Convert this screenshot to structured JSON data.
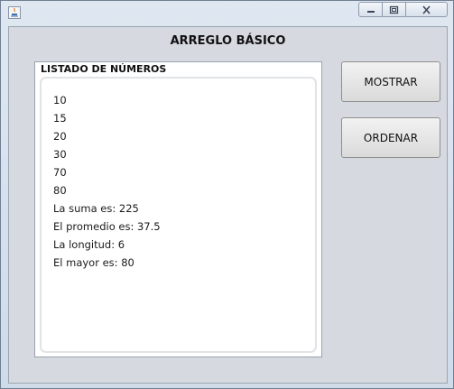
{
  "window": {
    "controls": {
      "minimize_icon": "minimize-icon",
      "maximize_icon": "maximize-icon",
      "close_icon": "close-icon"
    }
  },
  "main": {
    "title": "ARREGLO BÁSICO",
    "list_panel": {
      "title": "LISTADO DE NÚMEROS",
      "lines": [
        "10",
        "15",
        "20",
        "30",
        "70",
        "80",
        "La suma es: 225",
        "El promedio es: 37.5",
        "La longitud: 6",
        "El mayor es: 80"
      ]
    },
    "buttons": {
      "show_label": "MOSTRAR",
      "sort_label": "ORDENAR"
    }
  },
  "colors": {
    "frame_bg": "#d6d9df",
    "title_bar": "#dfe7f1"
  }
}
